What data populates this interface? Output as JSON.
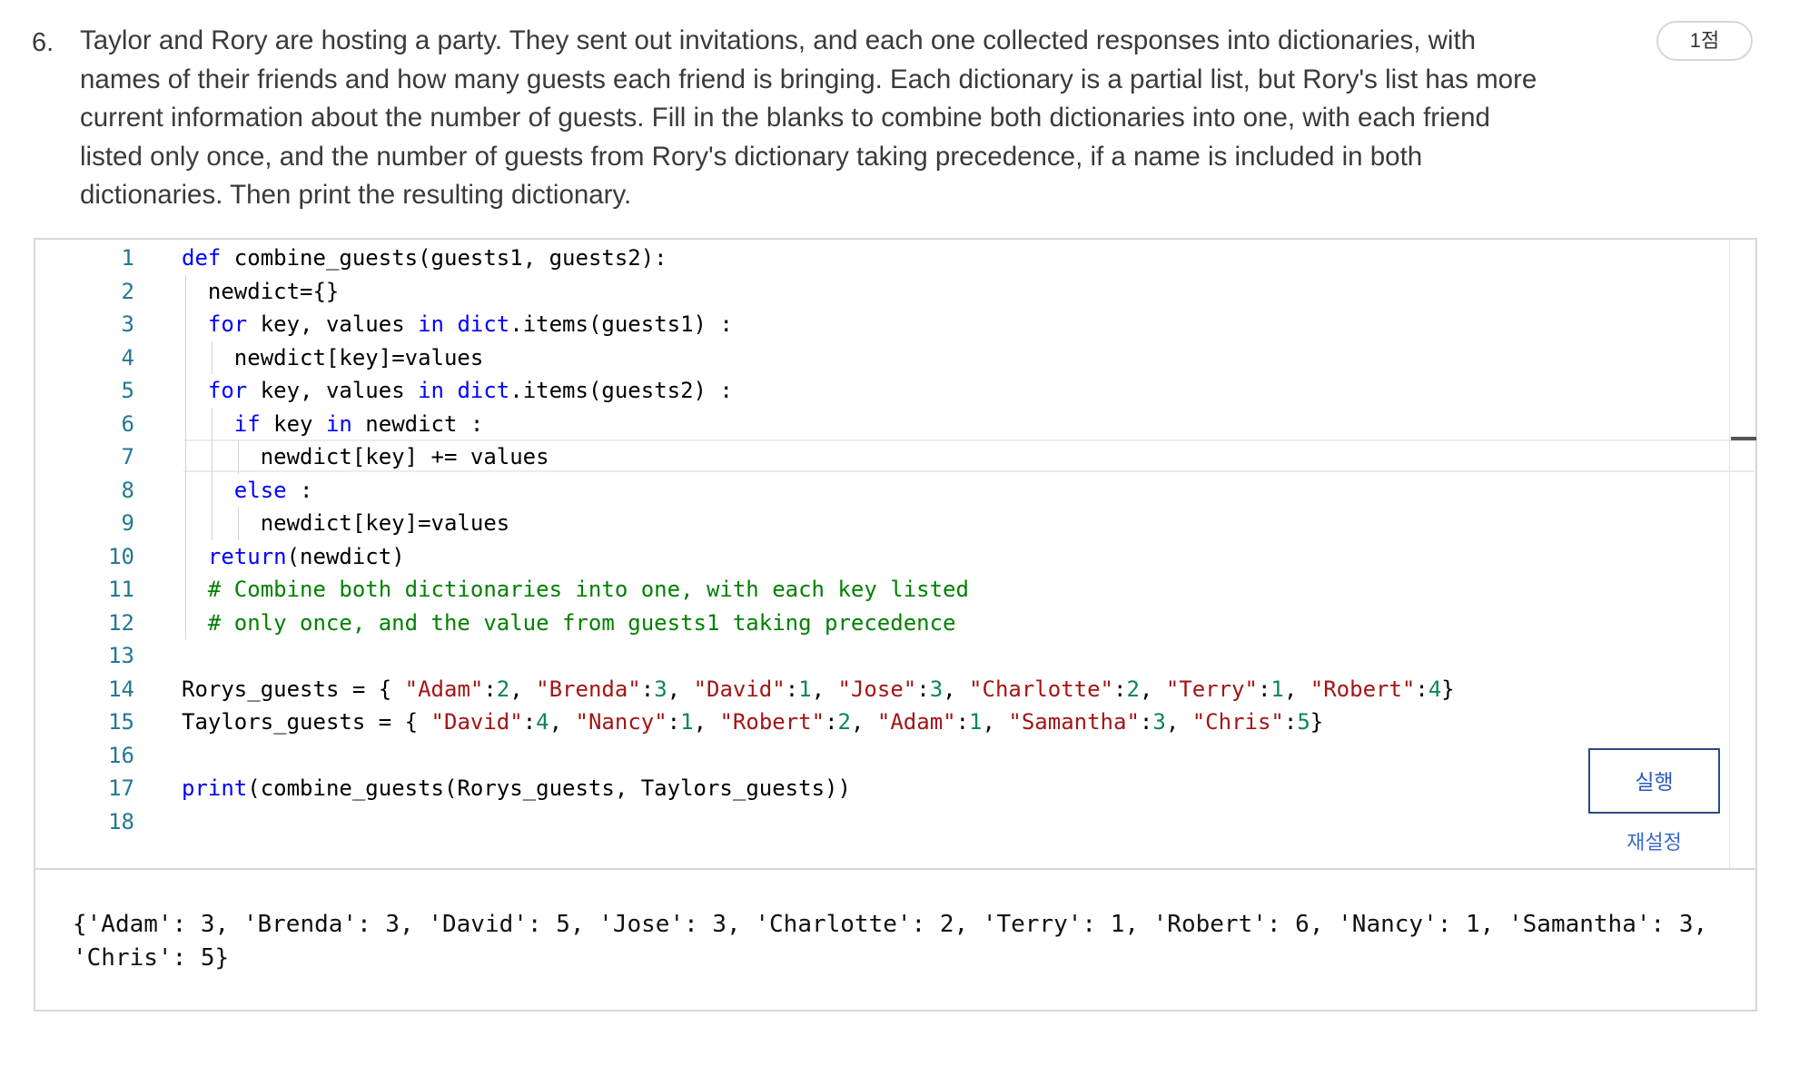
{
  "question": {
    "number": "6.",
    "text": "Taylor and Rory are hosting a party. They sent out invitations, and each one collected responses into dictionaries, with names of their friends and how many guests each friend is bringing. Each dictionary is a partial list, but Rory's list has more current information about the number of guests. Fill in the blanks to combine both dictionaries into one, with each friend listed only once, and the number of guests from Rory's dictionary taking precedence, if a name is included in both dictionaries. Then print the resulting dictionary.",
    "points": "1점"
  },
  "editor": {
    "line_numbers": [
      "1",
      "2",
      "3",
      "4",
      "5",
      "6",
      "7",
      "8",
      "9",
      "10",
      "11",
      "12",
      "13",
      "14",
      "15",
      "16",
      "17",
      "18"
    ],
    "colors": {
      "keyword": "#0000ff",
      "string": "#a31515",
      "number": "#098658",
      "comment": "#008000",
      "line_number": "#237893"
    },
    "lines": [
      [
        {
          "t": "def",
          "c": "kw"
        },
        {
          "t": " combine_guests(guests1, guests2):"
        }
      ],
      [
        {
          "t": "newdict={}"
        }
      ],
      [
        {
          "t": "for",
          "c": "kw"
        },
        {
          "t": " key, values "
        },
        {
          "t": "in",
          "c": "kw"
        },
        {
          "t": " "
        },
        {
          "t": "dict",
          "c": "kw"
        },
        {
          "t": ".items(guests1) :"
        }
      ],
      [
        {
          "t": "newdict[key]=values"
        }
      ],
      [
        {
          "t": "for",
          "c": "kw"
        },
        {
          "t": " key, values "
        },
        {
          "t": "in",
          "c": "kw"
        },
        {
          "t": " "
        },
        {
          "t": "dict",
          "c": "kw"
        },
        {
          "t": ".items(guests2) :"
        }
      ],
      [
        {
          "t": "if",
          "c": "kw"
        },
        {
          "t": " key "
        },
        {
          "t": "in",
          "c": "kw"
        },
        {
          "t": " newdict :"
        }
      ],
      [
        {
          "t": "newdict[key] += values"
        }
      ],
      [
        {
          "t": "else",
          "c": "kw"
        },
        {
          "t": " :"
        }
      ],
      [
        {
          "t": "newdict[key]=values"
        }
      ],
      [
        {
          "t": "return",
          "c": "kw"
        },
        {
          "t": "(newdict)"
        }
      ],
      [
        {
          "t": "# Combine both dictionaries into one, with each key listed",
          "c": "cmt"
        }
      ],
      [
        {
          "t": "# only once, and the value from guests1 taking precedence",
          "c": "cmt"
        }
      ],
      [],
      [
        {
          "t": "Rorys_guests = { "
        },
        {
          "t": "\"Adam\"",
          "c": "str"
        },
        {
          "t": ":"
        },
        {
          "t": "2",
          "c": "num"
        },
        {
          "t": ", "
        },
        {
          "t": "\"Brenda\"",
          "c": "str"
        },
        {
          "t": ":"
        },
        {
          "t": "3",
          "c": "num"
        },
        {
          "t": ", "
        },
        {
          "t": "\"David\"",
          "c": "str"
        },
        {
          "t": ":"
        },
        {
          "t": "1",
          "c": "num"
        },
        {
          "t": ", "
        },
        {
          "t": "\"Jose\"",
          "c": "str"
        },
        {
          "t": ":"
        },
        {
          "t": "3",
          "c": "num"
        },
        {
          "t": ", "
        },
        {
          "t": "\"Charlotte\"",
          "c": "str"
        },
        {
          "t": ":"
        },
        {
          "t": "2",
          "c": "num"
        },
        {
          "t": ", "
        },
        {
          "t": "\"Terry\"",
          "c": "str"
        },
        {
          "t": ":"
        },
        {
          "t": "1",
          "c": "num"
        },
        {
          "t": ", "
        },
        {
          "t": "\"Robert\"",
          "c": "str"
        },
        {
          "t": ":"
        },
        {
          "t": "4",
          "c": "num"
        },
        {
          "t": "}"
        }
      ],
      [
        {
          "t": "Taylors_guests = { "
        },
        {
          "t": "\"David\"",
          "c": "str"
        },
        {
          "t": ":"
        },
        {
          "t": "4",
          "c": "num"
        },
        {
          "t": ", "
        },
        {
          "t": "\"Nancy\"",
          "c": "str"
        },
        {
          "t": ":"
        },
        {
          "t": "1",
          "c": "num"
        },
        {
          "t": ", "
        },
        {
          "t": "\"Robert\"",
          "c": "str"
        },
        {
          "t": ":"
        },
        {
          "t": "2",
          "c": "num"
        },
        {
          "t": ", "
        },
        {
          "t": "\"Adam\"",
          "c": "str"
        },
        {
          "t": ":"
        },
        {
          "t": "1",
          "c": "num"
        },
        {
          "t": ", "
        },
        {
          "t": "\"Samantha\"",
          "c": "str"
        },
        {
          "t": ":"
        },
        {
          "t": "3",
          "c": "num"
        },
        {
          "t": ", "
        },
        {
          "t": "\"Chris\"",
          "c": "str"
        },
        {
          "t": ":"
        },
        {
          "t": "5",
          "c": "num"
        },
        {
          "t": "}"
        }
      ],
      [],
      [
        {
          "t": "print",
          "c": "kw"
        },
        {
          "t": "(combine_guests(Rorys_guests, Taylors_guests))"
        }
      ],
      []
    ]
  },
  "buttons": {
    "run_label": "실행",
    "reset_label": "재설정"
  },
  "output": {
    "text": "{'Adam': 3, 'Brenda': 3, 'David': 5, 'Jose': 3, 'Charlotte': 2, 'Terry': 1, 'Robert': 6, 'Nancy': 1, 'Samantha': 3, 'Chris': 5}"
  }
}
